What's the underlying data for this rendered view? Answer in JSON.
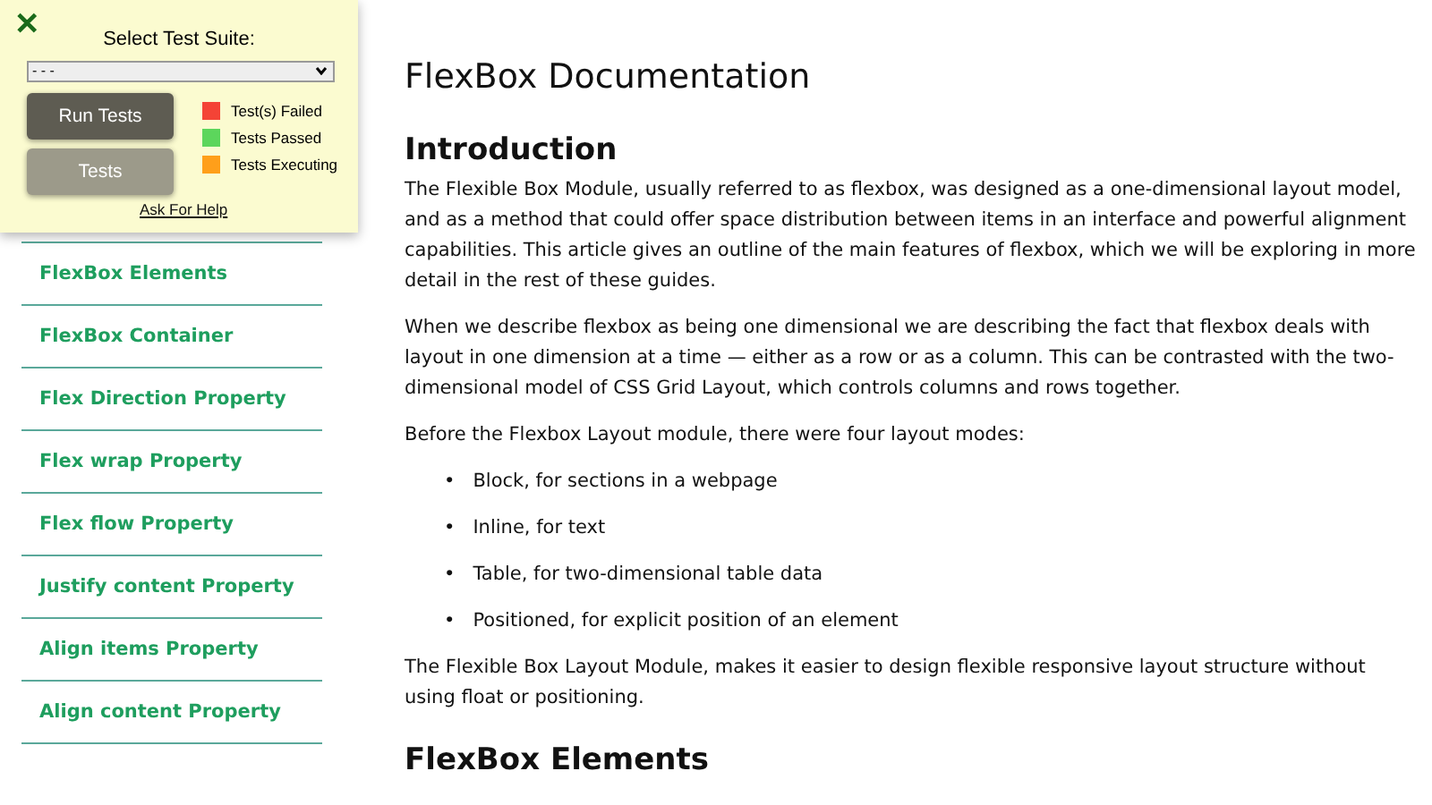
{
  "test_panel": {
    "close": "✕",
    "label": "Select Test Suite:",
    "suite": "- - -",
    "buttons": [
      {
        "label": "Run Tests",
        "disabled": false
      },
      {
        "label": "Tests",
        "disabled": true
      }
    ],
    "legend": [
      {
        "label": "Test(s) Failed",
        "color": "#f44336"
      },
      {
        "label": "Tests Passed",
        "color": "#5cd65c"
      },
      {
        "label": "Tests Executing",
        "color": "#ff9f1a"
      }
    ],
    "help": "Ask For Help"
  },
  "sidebar": {
    "items": [
      "FlexBox Elements",
      "FlexBox Container",
      "Flex Direction Property",
      "Flex wrap Property",
      "Flex flow Property",
      "Justify content Property",
      "Align items Property",
      "Align content Property"
    ]
  },
  "content": {
    "title": "FlexBox Documentation",
    "section": "Introduction",
    "paragraphs": [
      "The Flexible Box Module, usually referred to as flexbox, was designed as a one-dimensional layout model, and as a method that could offer space distribution between items in an interface and powerful alignment capabilities. This article gives an outline of the main features of flexbox, which we will be exploring in more detail in the rest of these guides.",
      "When we describe flexbox as being one dimensional we are describing the fact that flexbox deals with layout in one dimension at a time — either as a row or as a column. This can be contrasted with the two-dimensional model of CSS Grid Layout, which controls columns and rows together.",
      "Before the Flexbox Layout module, there were four layout modes:"
    ],
    "list": [
      {
        "bullet": "•",
        "text": "Block, for sections in a webpage"
      },
      {
        "bullet": "•",
        "text": "Inline, for text"
      },
      {
        "bullet": "•",
        "text": "Table, for two-dimensional table data"
      },
      {
        "bullet": "•",
        "text": "Positioned, for explicit position of an element"
      }
    ],
    "closing": "The Flexible Box Layout Module, makes it easier to design flexible responsive layout structure without using float or positioning.",
    "next_section": "FlexBox Elements"
  }
}
